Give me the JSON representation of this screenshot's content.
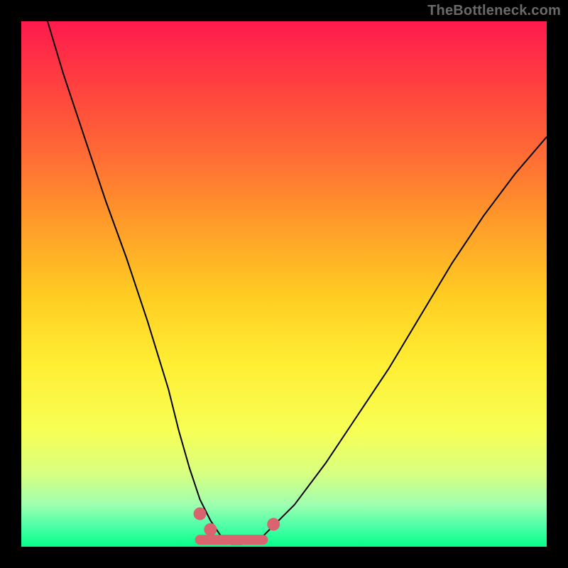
{
  "watermark": "TheBottleneck.com",
  "colors": {
    "marker": "#d9636e",
    "curve": "#000000"
  },
  "chart_data": {
    "type": "line",
    "title": "",
    "xlabel": "",
    "ylabel": "",
    "xlim": [
      0,
      100
    ],
    "ylim": [
      0,
      100
    ],
    "grid": false,
    "legend": false,
    "series": [
      {
        "name": "bottleneck-curve",
        "x": [
          5,
          8,
          12,
          16,
          20,
          24,
          28,
          30,
          32,
          34,
          36,
          38,
          40,
          42,
          46,
          52,
          58,
          64,
          70,
          76,
          82,
          88,
          94,
          100
        ],
        "y": [
          100,
          90,
          78,
          66,
          55,
          43,
          30,
          22,
          15,
          9,
          5,
          2,
          0.5,
          0.5,
          2,
          8,
          16,
          25,
          34,
          44,
          54,
          63,
          71,
          78
        ]
      }
    ],
    "markers": {
      "name": "highlighted-range",
      "x_start": 34,
      "x_end": 46,
      "y": 0.5
    }
  }
}
